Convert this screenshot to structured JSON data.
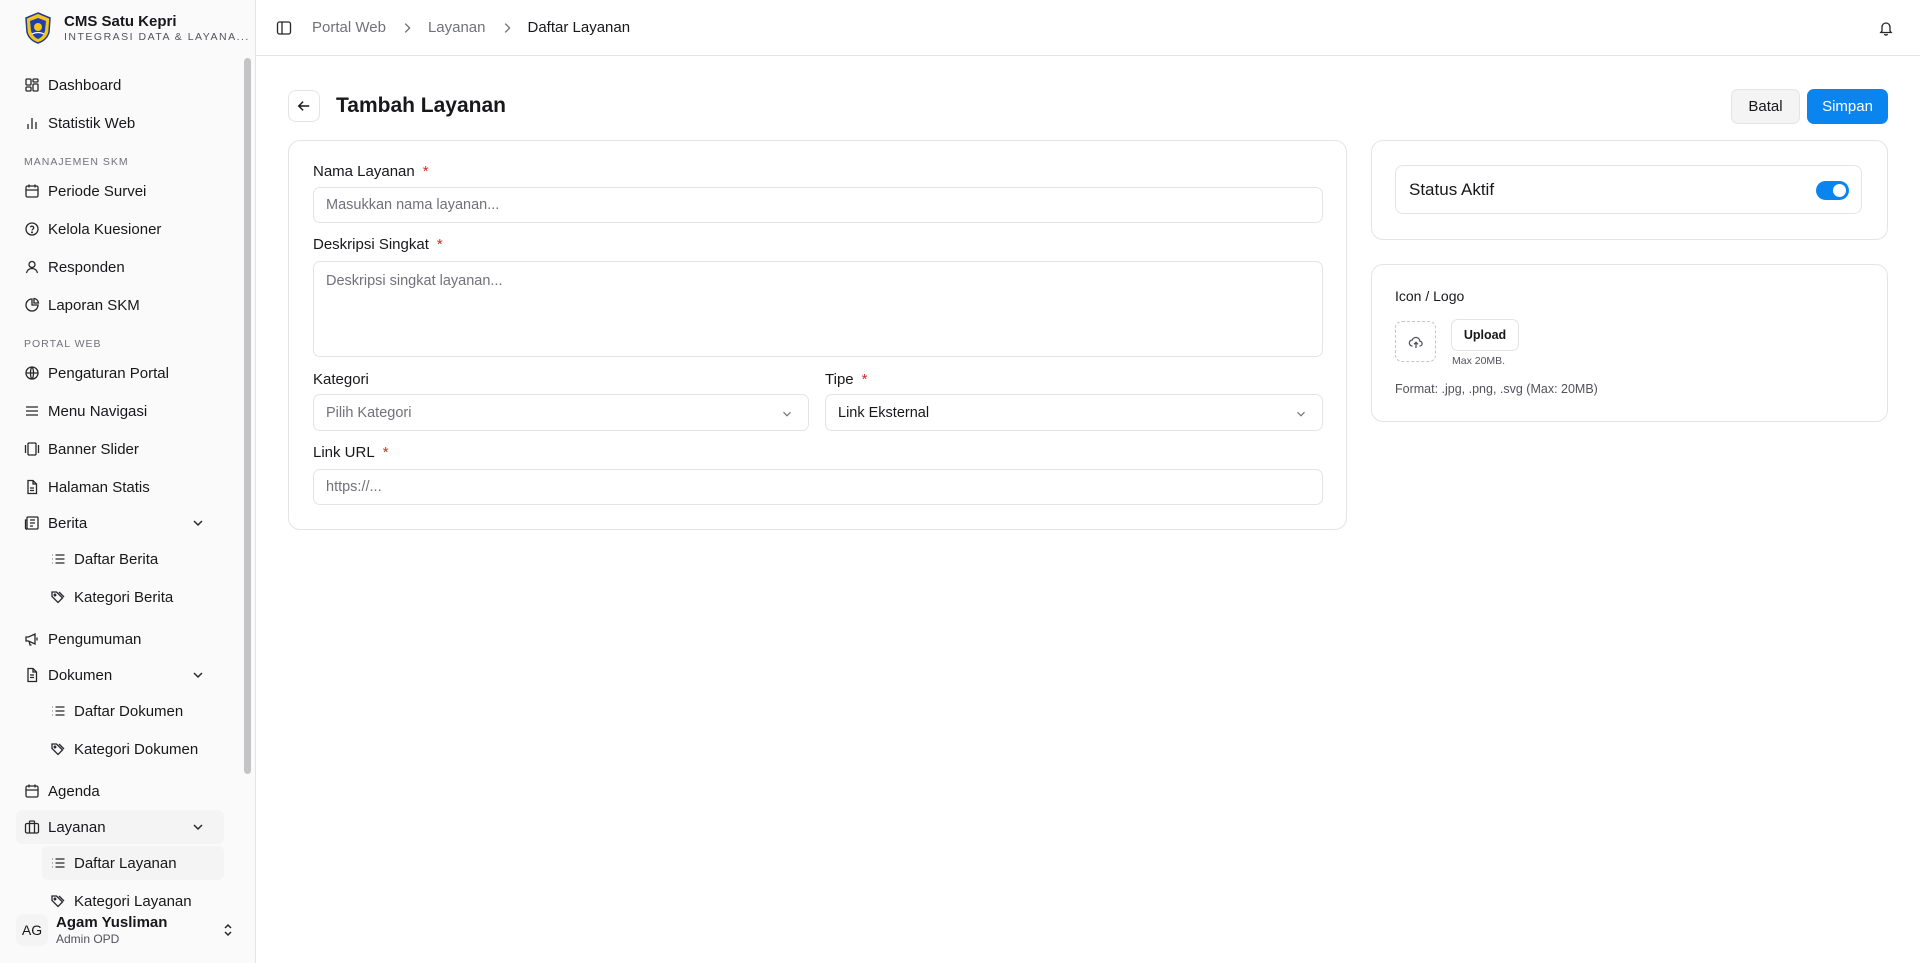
{
  "app": {
    "title": "CMS Satu Kepri",
    "subtitle": "INTEGRASI DATA & LAYANA..."
  },
  "sidebar": {
    "top": [
      {
        "label": "Dashboard"
      },
      {
        "label": "Statistik Web"
      }
    ],
    "group_skm": "MANAJEMEN SKM",
    "skm": [
      {
        "label": "Periode Survei"
      },
      {
        "label": "Kelola Kuesioner"
      },
      {
        "label": "Responden"
      },
      {
        "label": "Laporan SKM"
      }
    ],
    "group_portal": "PORTAL WEB",
    "portal": [
      {
        "label": "Pengaturan Portal"
      },
      {
        "label": "Menu Navigasi"
      },
      {
        "label": "Banner Slider"
      },
      {
        "label": "Halaman Statis"
      }
    ],
    "berita": {
      "label": "Berita",
      "children": [
        {
          "label": "Daftar Berita"
        },
        {
          "label": "Kategori Berita"
        }
      ]
    },
    "pengumuman": "Pengumuman",
    "dokumen": {
      "label": "Dokumen",
      "children": [
        {
          "label": "Daftar Dokumen"
        },
        {
          "label": "Kategori Dokumen"
        }
      ]
    },
    "agenda": "Agenda",
    "layanan": {
      "label": "Layanan",
      "children": [
        {
          "label": "Daftar Layanan"
        },
        {
          "label": "Kategori Layanan"
        }
      ]
    }
  },
  "user": {
    "initials": "AG",
    "name": "Agam Yusliman",
    "role": "Admin OPD"
  },
  "breadcrumb": [
    "Portal Web",
    "Layanan",
    "Daftar Layanan"
  ],
  "page": {
    "title": "Tambah Layanan",
    "cancel": "Batal",
    "save": "Simpan"
  },
  "form": {
    "nama_label": "Nama Layanan",
    "nama_placeholder": "Masukkan nama layanan...",
    "desc_label": "Deskripsi Singkat",
    "desc_placeholder": "Deskripsi singkat layanan...",
    "kategori_label": "Kategori",
    "kategori_value": "Pilih Kategori",
    "tipe_label": "Tipe",
    "tipe_value": "Link Eksternal",
    "url_label": "Link URL",
    "url_placeholder": "https://...",
    "required_mark": "*"
  },
  "status": {
    "label": "Status Aktif",
    "active": true
  },
  "icon_upload": {
    "label": "Icon / Logo",
    "button": "Upload",
    "max": "Max 20MB.",
    "format": "Format: .jpg, .png, .svg (Max: 20MB)"
  },
  "colors": {
    "accent": "#0a85f0",
    "required": "#dc2626"
  }
}
